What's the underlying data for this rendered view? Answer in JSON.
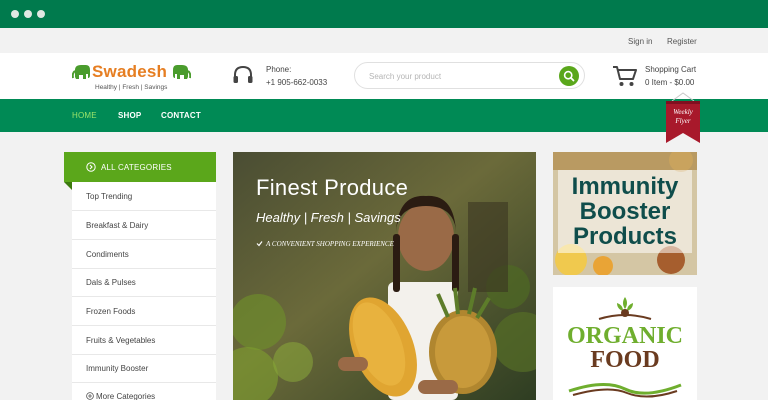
{
  "browser": {
    "window_controls": [
      "close",
      "minimize",
      "maximize"
    ]
  },
  "topbar": {
    "signin_label": "Sign in",
    "register_label": "Register"
  },
  "header": {
    "logo": {
      "name": "Swadesh",
      "tagline": "Healthy | Fresh | Savings",
      "icon": "elephant-icon"
    },
    "phone": {
      "label": "Phone:",
      "number": "+1 905-662-0033",
      "icon": "headphones-icon"
    },
    "search": {
      "placeholder": "Search your product",
      "value": "",
      "icon": "search-icon"
    },
    "cart": {
      "label": "Shopping Cart",
      "summary": "0 Item - $0.00",
      "icon": "cart-icon"
    }
  },
  "nav": {
    "items": [
      {
        "label": "HOME",
        "active": true
      },
      {
        "label": "SHOP",
        "active": false
      },
      {
        "label": "CONTACT",
        "active": false
      }
    ],
    "flyer": {
      "line1": "Weekly",
      "line2": "Flyer"
    }
  },
  "sidebar": {
    "header": "ALL CATEGORIES",
    "items": [
      {
        "label": "Top Trending"
      },
      {
        "label": "Breakfast & Dairy"
      },
      {
        "label": "Condiments"
      },
      {
        "label": "Dals & Pulses"
      },
      {
        "label": "Frozen Foods"
      },
      {
        "label": "Fruits & Vegetables"
      },
      {
        "label": "Immunity Booster"
      }
    ],
    "more": "More Categories"
  },
  "hero": {
    "title": "Finest Produce",
    "subtitle": "Healthy | Fresh | Savings",
    "tagline": "A CONVENIENT SHOPPING EXPERIENCE"
  },
  "promos": {
    "immunity": {
      "line1": "Immunity",
      "line2": "Booster",
      "line3": "Products"
    },
    "organic": {
      "line1": "ORGANIC",
      "line2": "FOOD"
    }
  },
  "colors": {
    "brand_green": "#008a55",
    "accent_green": "#5ba71b",
    "logo_orange": "#e67e22",
    "flyer_red": "#a8192b"
  }
}
